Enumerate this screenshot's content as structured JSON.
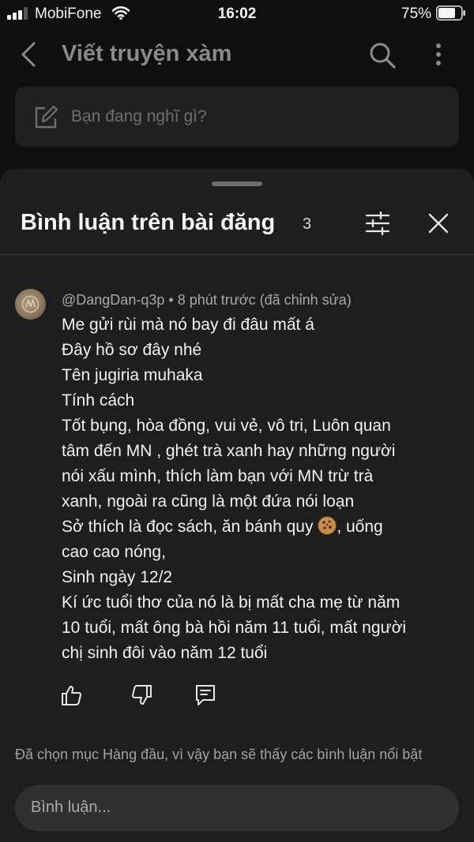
{
  "status_bar": {
    "carrier": "MobiFone",
    "time": "16:02",
    "battery_percent": "75%",
    "battery_level": 0.75,
    "signal_bars": 3
  },
  "header": {
    "back_icon": "chevron-left-icon",
    "title": "Viết truyện xàm",
    "search_icon": "search-icon",
    "more_icon": "vertical-dots-icon"
  },
  "composer": {
    "icon": "edit-icon",
    "placeholder": "Bạn đang nghĩ gì?"
  },
  "comments_sheet": {
    "title": "Bình luận trên bài đăng",
    "count": "3",
    "filter_icon": "sliders-icon",
    "close_icon": "close-icon",
    "comment": {
      "author": "@DangDan-q3p",
      "separator": "•",
      "time": "8 phút trước (đã chỉnh sửa)",
      "lines": [
        "Me gửi rùi mà nó bay đi đâu mất á",
        "Đây hồ sơ đây nhé",
        "Tên jugiria muhaka",
        "Tính cách",
        "Tốt bụng, hòa đồng, vui vẻ, vô tri, Luôn quan",
        "tâm đến MN , ghét trà xanh hay những người",
        "nói xấu mình, thích làm bạn với MN trừ trà",
        "xanh, ngoài ra cũng là một đứa nói loạn",
        "Sở thích là đọc sách, ăn bánh quy",
        ", uống",
        "cao cao nóng,",
        "Sinh ngày 12/2",
        "Kí ức tuổi thơ của nó là bị mất cha mẹ từ năm",
        "10 tuổi, mất ông bà hồi năm 11 tuổi, mất người",
        "chị sinh đôi vào năm 12 tuổi"
      ],
      "emoji_icon": "cookie-icon",
      "actions": {
        "like_icon": "thumbs-up-icon",
        "dislike_icon": "thumbs-down-icon",
        "reply_icon": "reply-icon"
      }
    },
    "notice": "Đã chọn mục Hàng đầu, vì vậy bạn sẽ thấy các bình luận nổi bật",
    "input_placeholder": "Bình luận..."
  }
}
